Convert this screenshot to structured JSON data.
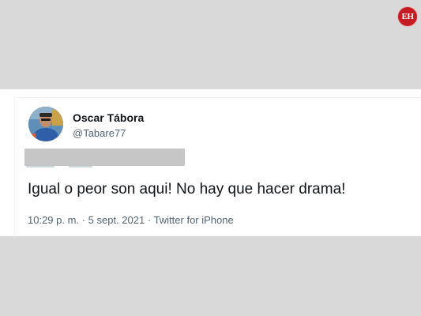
{
  "brand": {
    "logo_text": "EH",
    "logo_color": "#c41c22"
  },
  "tweet": {
    "author": {
      "name": "Oscar Tábora",
      "handle": "@Tabare77"
    },
    "text": "Igual o peor son aqui! No hay que hacer drama!",
    "time": "10:29 p. m.",
    "separator": "·",
    "date": "5 sept. 2021",
    "source": "Twitter for iPhone"
  },
  "colors": {
    "background": "#d9d9d9",
    "card": "#ffffff",
    "text_primary": "#0f1419",
    "text_secondary": "#536471",
    "redaction": "#c6c6c6"
  }
}
